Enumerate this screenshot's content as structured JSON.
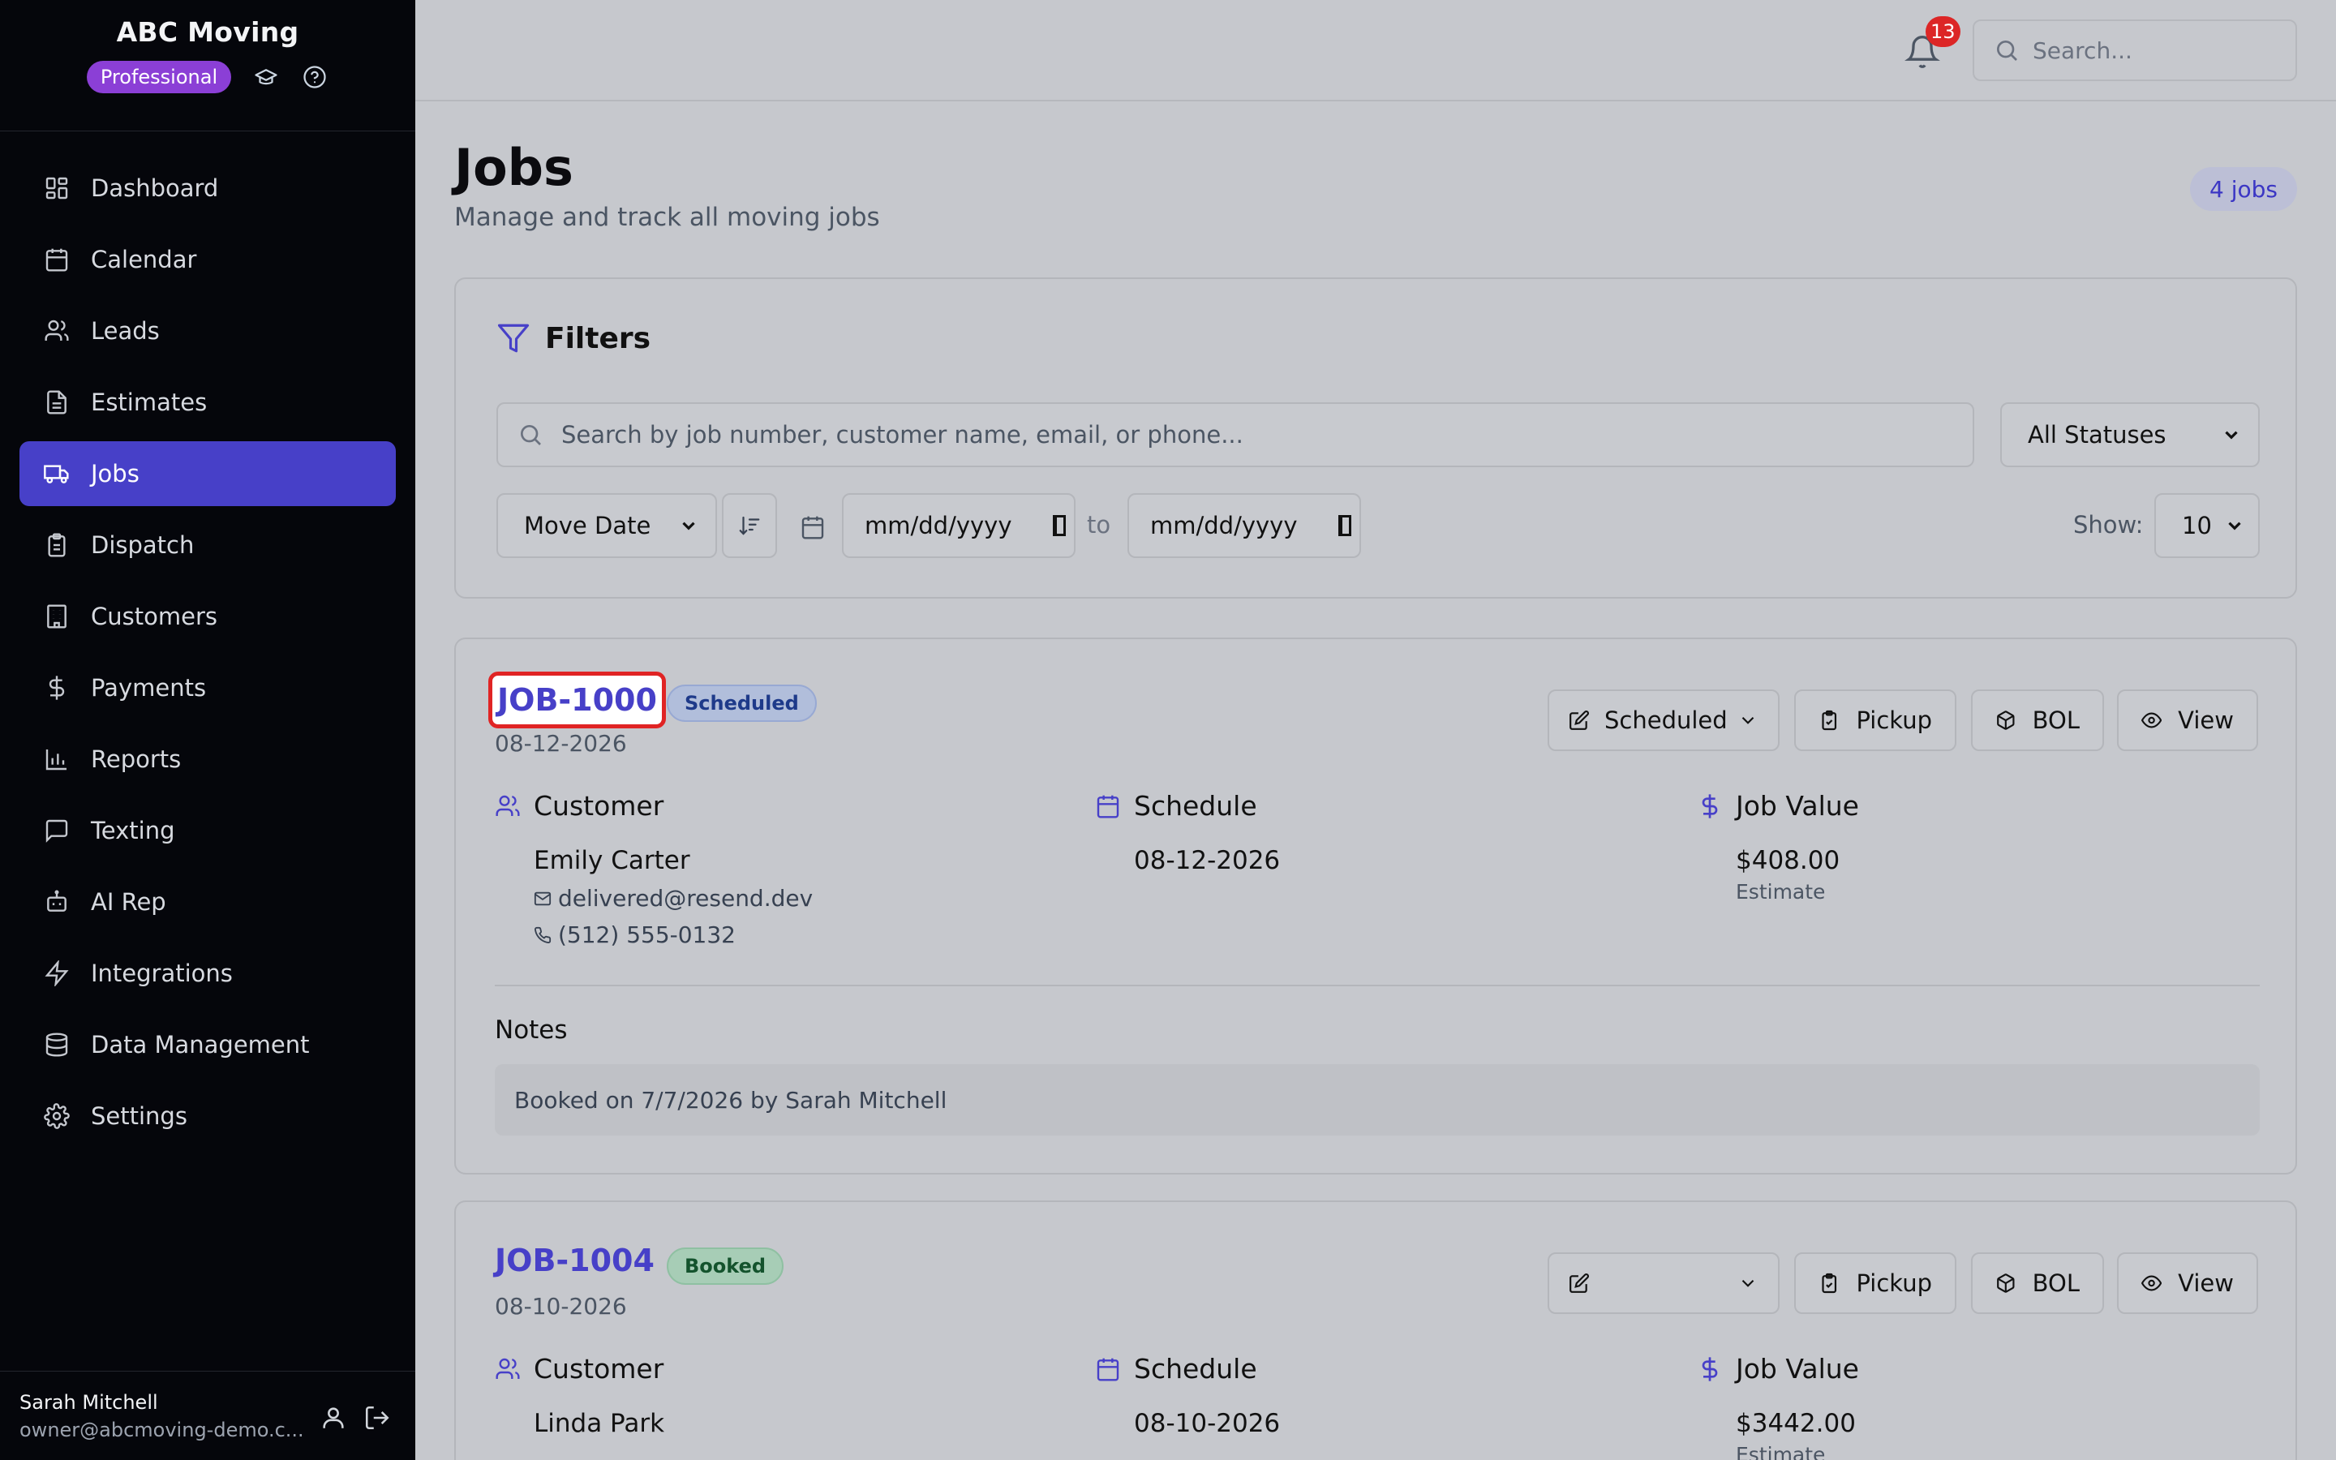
{
  "app": {
    "name": "ABC Moving",
    "plan": "Professional"
  },
  "sidebar": {
    "items": [
      {
        "label": "Dashboard",
        "icon": "dashboard-icon"
      },
      {
        "label": "Calendar",
        "icon": "calendar-icon"
      },
      {
        "label": "Leads",
        "icon": "users-icon"
      },
      {
        "label": "Estimates",
        "icon": "document-icon"
      },
      {
        "label": "Jobs",
        "icon": "truck-icon",
        "active": true
      },
      {
        "label": "Dispatch",
        "icon": "clipboard-icon"
      },
      {
        "label": "Customers",
        "icon": "building-icon"
      },
      {
        "label": "Payments",
        "icon": "dollar-icon"
      },
      {
        "label": "Reports",
        "icon": "bar-chart-icon"
      },
      {
        "label": "Texting",
        "icon": "message-icon"
      },
      {
        "label": "AI Rep",
        "icon": "bot-icon"
      },
      {
        "label": "Integrations",
        "icon": "zap-icon"
      },
      {
        "label": "Data Management",
        "icon": "database-icon"
      },
      {
        "label": "Settings",
        "icon": "gear-icon"
      }
    ]
  },
  "user": {
    "name": "Sarah Mitchell",
    "email": "owner@abcmoving-demo.c..."
  },
  "topbar": {
    "notification_count": "13",
    "search_placeholder": "Search..."
  },
  "page": {
    "title": "Jobs",
    "subtitle": "Manage and track all moving jobs",
    "count": "4 jobs"
  },
  "filters": {
    "title": "Filters",
    "search_placeholder": "Search by job number, customer name, email, or phone...",
    "status_value": "All Statuses",
    "sort_value": "Move Date",
    "date_from_placeholder": "mm/dd/yyyy",
    "date_to_placeholder": "mm/dd/yyyy",
    "to_label": "to",
    "show_label": "Show:",
    "show_value": "10"
  },
  "labels": {
    "customer": "Customer",
    "schedule": "Schedule",
    "job_value": "Job Value",
    "notes": "Notes",
    "pickup": "Pickup",
    "bol": "BOL",
    "view": "View"
  },
  "jobs": [
    {
      "number": "JOB-1000",
      "status": "Scheduled",
      "date": "08-12-2026",
      "status_select": "Scheduled",
      "customer_name": "Emily Carter",
      "email": "delivered@resend.dev",
      "phone": "(512) 555-0132",
      "schedule_date": "08-12-2026",
      "value": "$408.00",
      "value_type": "Estimate",
      "notes": "Booked on 7/7/2026 by Sarah Mitchell"
    },
    {
      "number": "JOB-1004",
      "status": "Booked",
      "date": "08-10-2026",
      "status_select": "",
      "customer_name": "Linda Park",
      "schedule_date": "08-10-2026",
      "value": "$3442.00",
      "value_type": "Estimate"
    }
  ]
}
